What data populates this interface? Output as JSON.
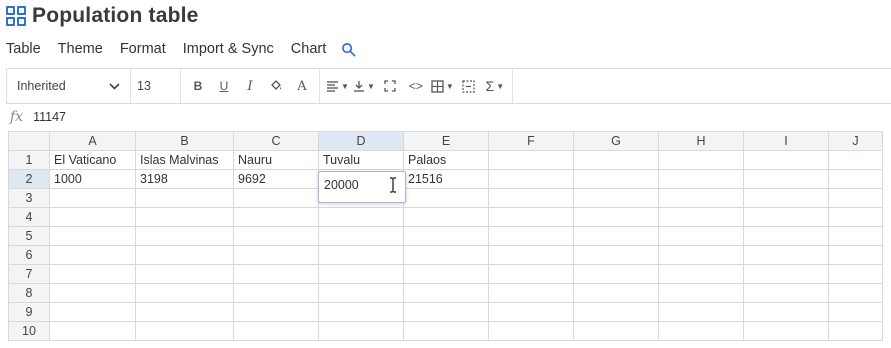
{
  "app": {
    "title": "Population table",
    "title_icon": "grid-icon"
  },
  "menu": {
    "items": [
      "Table",
      "Theme",
      "Format",
      "Import & Sync",
      "Chart"
    ],
    "search_icon": "search-icon"
  },
  "toolbar": {
    "font_family": "Inherited",
    "font_size": "13",
    "bold": "B",
    "underline": "U",
    "italic": "I",
    "text_color": "A",
    "sum": "Σ",
    "code": "<>"
  },
  "formula_bar": {
    "fx_label": "fx",
    "value": "11147"
  },
  "sheet": {
    "columns": [
      "A",
      "B",
      "C",
      "D",
      "E",
      "F",
      "G",
      "H",
      "I",
      "J"
    ],
    "selected_column": "D",
    "rows": [
      {
        "num": "1",
        "cells": [
          "El Vaticano",
          "Islas Malvinas",
          "Nauru",
          "Tuvalu",
          "Palaos",
          "",
          "",
          "",
          "",
          ""
        ]
      },
      {
        "num": "2",
        "cells": [
          "1000",
          "3198",
          "9692",
          "",
          "21516",
          "",
          "",
          "",
          "",
          ""
        ]
      },
      {
        "num": "3",
        "cells": [
          "",
          "",
          "",
          "",
          "",
          "",
          "",
          "",
          "",
          ""
        ]
      },
      {
        "num": "4",
        "cells": [
          "",
          "",
          "",
          "",
          "",
          "",
          "",
          "",
          "",
          ""
        ]
      },
      {
        "num": "5",
        "cells": [
          "",
          "",
          "",
          "",
          "",
          "",
          "",
          "",
          "",
          ""
        ]
      },
      {
        "num": "6",
        "cells": [
          "",
          "",
          "",
          "",
          "",
          "",
          "",
          "",
          "",
          ""
        ]
      },
      {
        "num": "7",
        "cells": [
          "",
          "",
          "",
          "",
          "",
          "",
          "",
          "",
          "",
          ""
        ]
      },
      {
        "num": "8",
        "cells": [
          "",
          "",
          "",
          "",
          "",
          "",
          "",
          "",
          "",
          ""
        ]
      },
      {
        "num": "9",
        "cells": [
          "",
          "",
          "",
          "",
          "",
          "",
          "",
          "",
          "",
          ""
        ]
      },
      {
        "num": "10",
        "cells": [
          "",
          "",
          "",
          "",
          "",
          "",
          "",
          "",
          "",
          ""
        ]
      }
    ],
    "editing_cell": {
      "ref": "D2",
      "value": "20000"
    }
  },
  "colors": {
    "accent": "#2f6fd6",
    "header_bg": "#f3f4f6",
    "selected_header_bg": "#dfe7f3",
    "gridline": "#d9d9d9"
  }
}
